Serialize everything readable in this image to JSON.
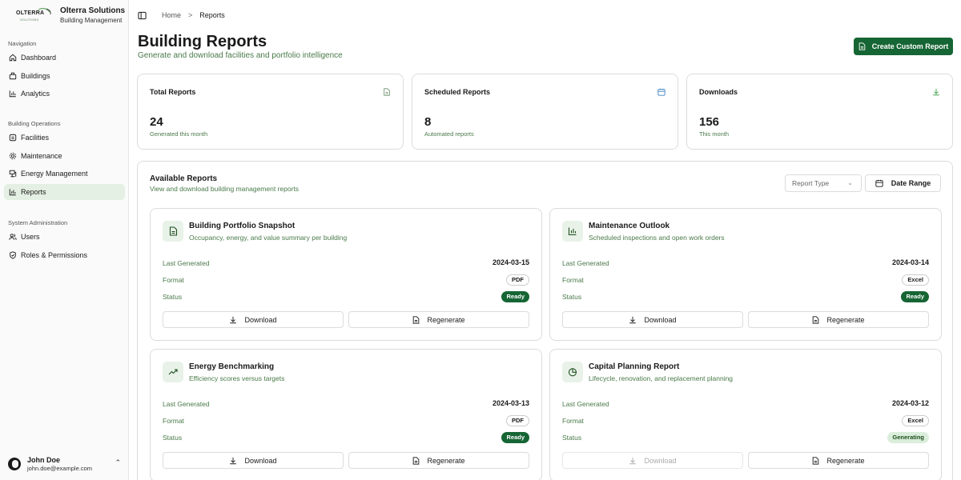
{
  "brand": {
    "logo_text": "OLTERRA",
    "logo_sub": "SOLUTIONS",
    "name": "Olterra Solutions",
    "subtitle": "Building Management"
  },
  "sidebar": {
    "sections": [
      {
        "label": "Navigation",
        "items": [
          {
            "label": "Dashboard",
            "icon": "home-icon"
          },
          {
            "label": "Buildings",
            "icon": "building-icon"
          },
          {
            "label": "Analytics",
            "icon": "bar-chart-icon"
          }
        ]
      },
      {
        "label": "Building Operations",
        "items": [
          {
            "label": "Facilities",
            "icon": "facility-icon"
          },
          {
            "label": "Maintenance",
            "icon": "gear-icon"
          },
          {
            "label": "Energy Management",
            "icon": "energy-icon"
          },
          {
            "label": "Reports",
            "icon": "bar-chart-icon",
            "active": true
          }
        ]
      },
      {
        "label": "System Administration",
        "items": [
          {
            "label": "Users",
            "icon": "users-icon"
          },
          {
            "label": "Roles & Permissions",
            "icon": "shield-icon"
          }
        ]
      }
    ]
  },
  "user": {
    "name": "John Doe",
    "email": "john.doe@example.com"
  },
  "breadcrumb": {
    "home": "Home",
    "separator": ">",
    "current": "Reports"
  },
  "header": {
    "title": "Building Reports",
    "subtitle": "Generate and download facilities and portfolio intelligence",
    "create_button": "Create Custom Report"
  },
  "stats": [
    {
      "title": "Total Reports",
      "value": "24",
      "note": "Generated this month",
      "icon": "file-icon"
    },
    {
      "title": "Scheduled Reports",
      "value": "8",
      "note": "Automated reports",
      "icon": "calendar-icon"
    },
    {
      "title": "Downloads",
      "value": "156",
      "note": "This month",
      "icon": "download-icon"
    }
  ],
  "reports_panel": {
    "title": "Available Reports",
    "subtitle": "View and download building management reports",
    "filter_placeholder": "Report Type",
    "date_range_button": "Date Range",
    "labels": {
      "last_generated": "Last Generated",
      "format": "Format",
      "status": "Status",
      "download": "Download",
      "regenerate": "Regenerate"
    },
    "reports": [
      {
        "title": "Building Portfolio Snapshot",
        "subtitle": "Occupancy, energy, and value summary per building",
        "icon": "file-icon",
        "last_generated": "2024-03-15",
        "format": "PDF",
        "status": "Ready",
        "download_enabled": true
      },
      {
        "title": "Maintenance Outlook",
        "subtitle": "Scheduled inspections and open work orders",
        "icon": "bar-chart-icon",
        "last_generated": "2024-03-14",
        "format": "Excel",
        "status": "Ready",
        "download_enabled": true
      },
      {
        "title": "Energy Benchmarking",
        "subtitle": "Efficiency scores versus targets",
        "icon": "trend-up-icon",
        "last_generated": "2024-03-13",
        "format": "PDF",
        "status": "Ready",
        "download_enabled": true
      },
      {
        "title": "Capital Planning Report",
        "subtitle": "Lifecycle, renovation, and replacement planning",
        "icon": "pie-chart-icon",
        "last_generated": "2024-03-12",
        "format": "Excel",
        "status": "Generating",
        "download_enabled": false
      }
    ]
  },
  "colors": {
    "primary": "#166534",
    "accent_text": "#4a7a4a",
    "active_nav": "#e3f0e3",
    "generating_badge": "#dbeedb"
  }
}
